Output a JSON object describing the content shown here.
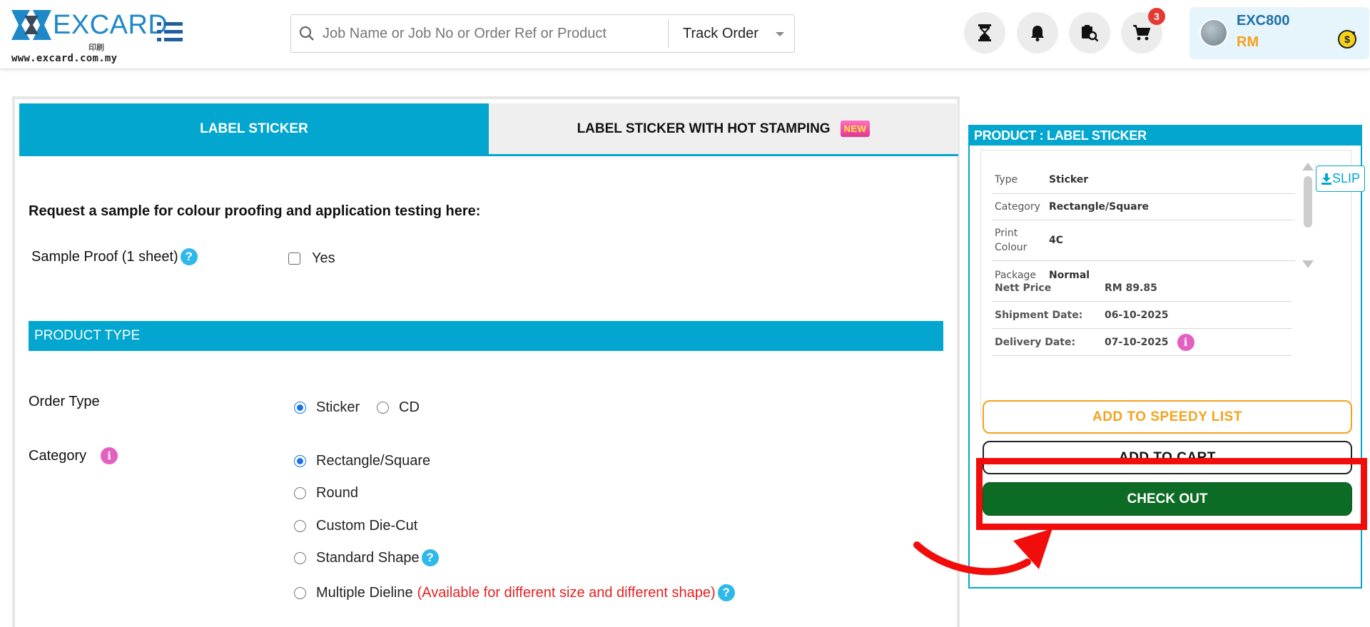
{
  "brand": {
    "name": "EXCARD",
    "sub": "印刷",
    "url": "www.excard.com.my"
  },
  "search": {
    "placeholder": "Job Name or Job No or Order Ref or Product",
    "track_label": "Track Order"
  },
  "header_icons": {
    "cart_count": "3"
  },
  "user": {
    "id": "EXC800",
    "currency": "RM"
  },
  "tabs": [
    {
      "label": "LABEL STICKER",
      "active": true
    },
    {
      "label": "LABEL STICKER WITH HOT STAMPING",
      "badge": "NEW",
      "active": false
    }
  ],
  "sample": {
    "title": "Request a sample for colour proofing and application testing here:",
    "label": "Sample Proof (1 sheet)",
    "option": "Yes"
  },
  "section": {
    "product_type": "PRODUCT TYPE"
  },
  "order_type": {
    "label": "Order Type",
    "options": [
      "Sticker",
      "CD"
    ],
    "selected": "Sticker"
  },
  "category": {
    "label": "Category",
    "options": [
      "Rectangle/Square",
      "Round",
      "Custom Die-Cut",
      "Standard Shape",
      "Multiple Dieline"
    ],
    "selected": "Rectangle/Square",
    "multiple_note": "(Available for different size and different shape)"
  },
  "product_panel": {
    "title": "PRODUCT : LABEL STICKER",
    "slip_label": "SLIP",
    "specs": [
      {
        "key": "Type",
        "value": "Sticker"
      },
      {
        "key": "Category",
        "value": "Rectangle/Square"
      },
      {
        "key": "Print Colour",
        "value": "4C"
      },
      {
        "key": "Package",
        "value": "Normal"
      }
    ],
    "prices": [
      {
        "key": "Nett Price",
        "value": "RM 89.85"
      },
      {
        "key": "Shipment Date:",
        "value": "06-10-2025"
      },
      {
        "key": "Delivery Date:",
        "value": "07-10-2025"
      }
    ],
    "buttons": {
      "speedy": "ADD TO SPEEDY LIST",
      "cart": "ADD TO CART",
      "checkout": "CHECK OUT"
    }
  },
  "colors": {
    "primary": "#02a6cf",
    "speedy": "#f5a21f",
    "checkout": "#0c6b24",
    "highlight": "#f20d0d"
  }
}
